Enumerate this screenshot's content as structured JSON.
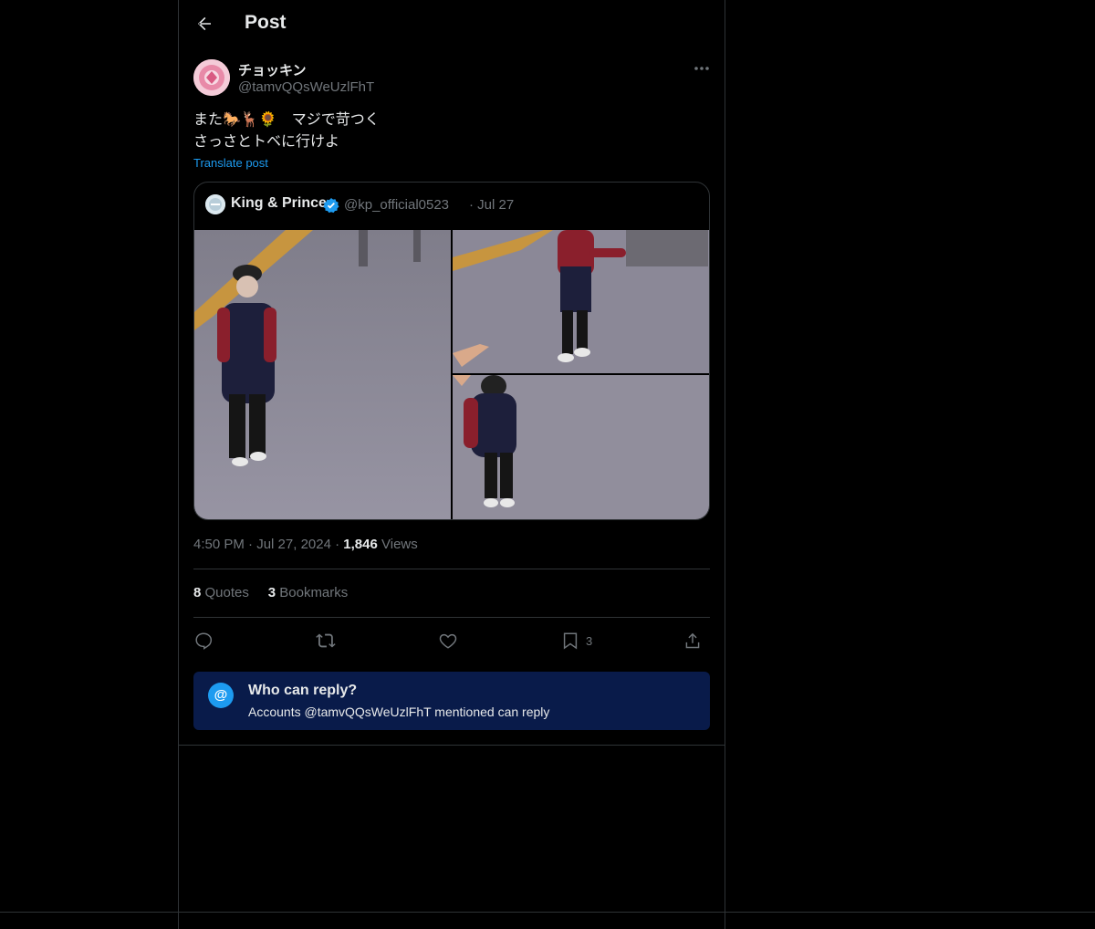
{
  "header": {
    "title": "Post",
    "back_icon": "arrow-left-icon"
  },
  "post": {
    "author_name": "チョッキン",
    "author_handle": "@tamvQQsWeUzlFhT",
    "text_line1": "また🐎🦌🌻　マジで苛つく",
    "text_line2": "さっさとトベに行けよ",
    "translate_label": "Translate post",
    "time": "4:50 PM",
    "date": "Jul 27, 2024",
    "views_count": "1,846",
    "views_label": "Views",
    "sep": "·"
  },
  "quoted": {
    "name": "King & Prince",
    "handle": "@kp_official0523",
    "date": "Jul 27",
    "sep": "·"
  },
  "stats": {
    "quotes_count": "8",
    "quotes_label": "Quotes",
    "bookmarks_count": "3",
    "bookmarks_label": "Bookmarks"
  },
  "actions": {
    "bookmark_count": "3"
  },
  "reply_restriction": {
    "title": "Who can reply?",
    "subtitle": "Accounts @tamvQQsWeUzlFhT mentioned can reply",
    "icon_text": "@"
  },
  "colors": {
    "background": "#000000",
    "border": "#2f3336",
    "accent": "#1d9bf0",
    "muted_text": "#71767b",
    "reply_box_bg": "#091b4a"
  }
}
